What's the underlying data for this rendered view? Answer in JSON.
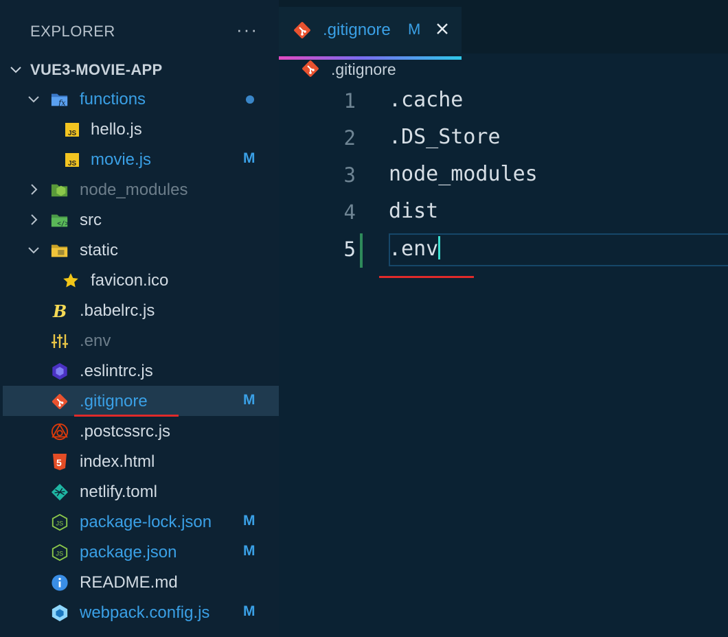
{
  "sidebar": {
    "title": "EXPLORER",
    "more_label": "···",
    "project_name": "VUE3-MOVIE-APP",
    "items": [
      {
        "label": "functions",
        "badge": ""
      },
      {
        "label": "hello.js",
        "badge": ""
      },
      {
        "label": "movie.js",
        "badge": "M"
      },
      {
        "label": "node_modules",
        "badge": ""
      },
      {
        "label": "src",
        "badge": ""
      },
      {
        "label": "static",
        "badge": ""
      },
      {
        "label": "favicon.ico",
        "badge": ""
      },
      {
        "label": ".babelrc.js",
        "badge": ""
      },
      {
        "label": ".env",
        "badge": ""
      },
      {
        "label": ".eslintrc.js",
        "badge": ""
      },
      {
        "label": ".gitignore",
        "badge": "M"
      },
      {
        "label": ".postcssrc.js",
        "badge": ""
      },
      {
        "label": "index.html",
        "badge": ""
      },
      {
        "label": "netlify.toml",
        "badge": ""
      },
      {
        "label": "package-lock.json",
        "badge": "M"
      },
      {
        "label": "package.json",
        "badge": "M"
      },
      {
        "label": "README.md",
        "badge": ""
      },
      {
        "label": "webpack.config.js",
        "badge": "M"
      }
    ]
  },
  "editor": {
    "tab": {
      "label": ".gitignore",
      "badge": "M"
    },
    "breadcrumb": ".gitignore",
    "lines": [
      {
        "num": "1",
        "text": ".cache"
      },
      {
        "num": "2",
        "text": ".DS_Store"
      },
      {
        "num": "3",
        "text": "node_modules"
      },
      {
        "num": "4",
        "text": "dist"
      },
      {
        "num": "5",
        "text": ".env"
      }
    ]
  },
  "colors": {
    "accent_blue": "#3aa0e6",
    "git_orange": "#e8522f",
    "highlight_red": "#e02a2a"
  }
}
